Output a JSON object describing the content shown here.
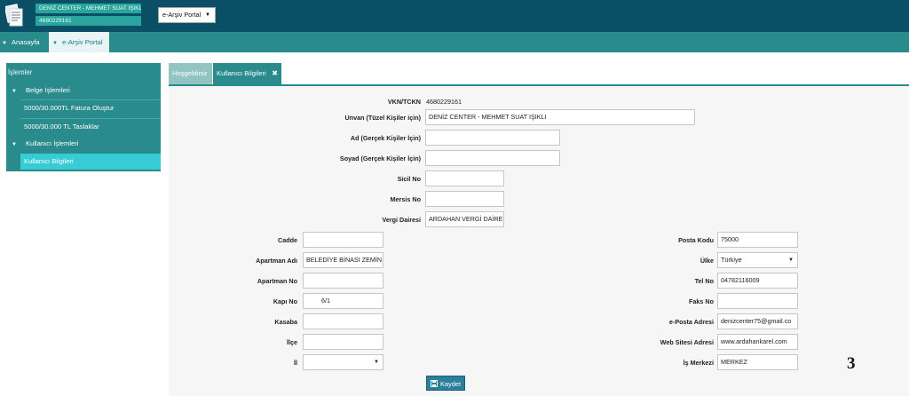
{
  "header": {
    "company_name": "DENİZ CENTER - MEHMET SUAT IŞIKLI",
    "company_vkn": "4680229161",
    "portal_select": "e-Arşiv Portal"
  },
  "nav": {
    "home": "Anasayfa",
    "portal": "e-Arşiv Portal"
  },
  "sidebar": {
    "title": "İşlemler",
    "items": [
      {
        "label": "Belge İşlemleri"
      },
      {
        "label": "5000/30.000TL Fatura Oluştur"
      },
      {
        "label": "5000/30.000 TL Taslaklar"
      },
      {
        "label": "Kullanıcı İşlemleri"
      },
      {
        "label": "Kullanıcı Bilgileri"
      }
    ]
  },
  "tabs": {
    "welcome": "Hoşgeldiniz",
    "user": "Kullanıcı Bilgileri",
    "close": "✖"
  },
  "form": {
    "vkn_label": "VKN/TCKN",
    "vkn_value": "4680229161",
    "unvan_label": "Unvan (Tüzel Kişiler için)",
    "unvan_value": "DENİZ CENTER - MEHMET SUAT IŞIKLI",
    "ad_label": "Ad (Gerçek Kişiler İçin)",
    "ad_value": "",
    "soyad_label": "Soyad (Gerçek Kişiler İçin)",
    "soyad_value": "",
    "sicil_label": "Sicil No",
    "sicil_value": "",
    "mersis_label": "Mersis No",
    "mersis_value": "",
    "vergi_label": "Vergi Dairesi",
    "vergi_value": "ARDAHAN VERGİ DAİRES",
    "cadde_label": "Cadde",
    "cadde_value": "",
    "apartman_adi_label": "Apartman Adı",
    "apartman_adi_value": "BELEDİYE BİNASI ZEMİN",
    "apartman_no_label": "Apartman No",
    "apartman_no_value": "",
    "kapi_label": "Kapı No",
    "kapi_value": "6/1",
    "kasaba_label": "Kasaba",
    "kasaba_value": "",
    "ilce_label": "İlçe",
    "ilce_value": "",
    "il_label": "İl",
    "il_value": "",
    "posta_label": "Posta Kodu",
    "posta_value": "75000",
    "ulke_label": "Ülke",
    "ulke_value": "Türkiye",
    "tel_label": "Tel No",
    "tel_value": "04782116009",
    "faks_label": "Faks No",
    "faks_value": "",
    "eposta_label": "e-Posta Adresi",
    "eposta_value": "denizcenter75@gmail.co",
    "web_label": "Web Sitesi Adresi",
    "web_value": "www.ardahankarel.com",
    "is_merkezi_label": "İş Merkezi",
    "is_merkezi_value": "MERKEZ",
    "save_label": "Kaydet"
  },
  "page_number": "3",
  "colors": {
    "topbar": "#0b4f66",
    "teal": "#2a8b8c",
    "active": "#37cbd6",
    "badge": "#2aa59d"
  }
}
